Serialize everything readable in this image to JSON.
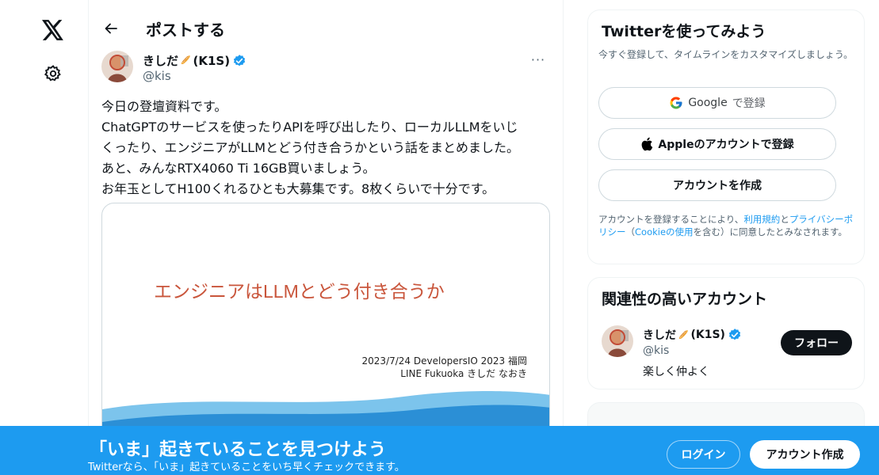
{
  "header": {
    "title": "ポストする"
  },
  "post": {
    "author_name": "きしだ",
    "author_suffix": "(K1S)",
    "author_handle": "@kis",
    "more": "···",
    "text_lines": [
      "今日の登壇資料です。",
      "ChatGPTのサービスを使ったりAPIを呼び出したり、ローカルLLMをいじ",
      "くったり、エンジニアがLLMとどう付き合うかという話をまとめました。",
      "あと、みんなRTX4060 Ti 16GB買いましょう。",
      "お年玉としてH100くれるひとも大募集です。8枚くらいで十分です。"
    ],
    "slide": {
      "title": "エンジニアはLLMとどう付き合うか",
      "date_line": "2023/7/24 DevelopersIO 2023 福岡",
      "author_line": "LINE Fukuoka きしだ なおき"
    }
  },
  "signup": {
    "title": "Twitterを使ってみよう",
    "subtitle": "今すぐ登録して、タイムラインをカスタマイズしましょう。",
    "google_label": "Google",
    "google_suffix": "で登録",
    "apple_label": "Appleのアカウントで登録",
    "create_label": "アカウントを作成",
    "legal_pre": "アカウントを登録することにより、",
    "legal_terms": "利用規約",
    "legal_and": "と",
    "legal_privacy": "プライバシーポリシー",
    "legal_paren_open": "（",
    "legal_cookie": "Cookieの使用",
    "legal_post": "を含む）に同意したとみなされます。"
  },
  "related": {
    "title": "関連性の高いアカウント",
    "name": "きしだ",
    "suffix": "(K1S)",
    "handle": "@kis",
    "bio": "楽しく仲よく",
    "follow_label": "フォロー"
  },
  "banner": {
    "title": "「いま」起きていることを見つけよう",
    "subtitle": "Twitterなら、「いま」起きていることをいち早くチェックできます。",
    "login_label": "ログイン",
    "create_label": "アカウント作成"
  },
  "colors": {
    "accent": "#1d9bf0",
    "text": "#0f1419",
    "secondary": "#536471",
    "slide_title": "#c9553b"
  },
  "icons": {
    "logo": "x-logo-icon",
    "settings": "gear-icon",
    "back": "arrow-left-icon",
    "verified": "verified-badge-icon",
    "google": "google-logo-icon",
    "apple": "apple-logo-icon"
  }
}
